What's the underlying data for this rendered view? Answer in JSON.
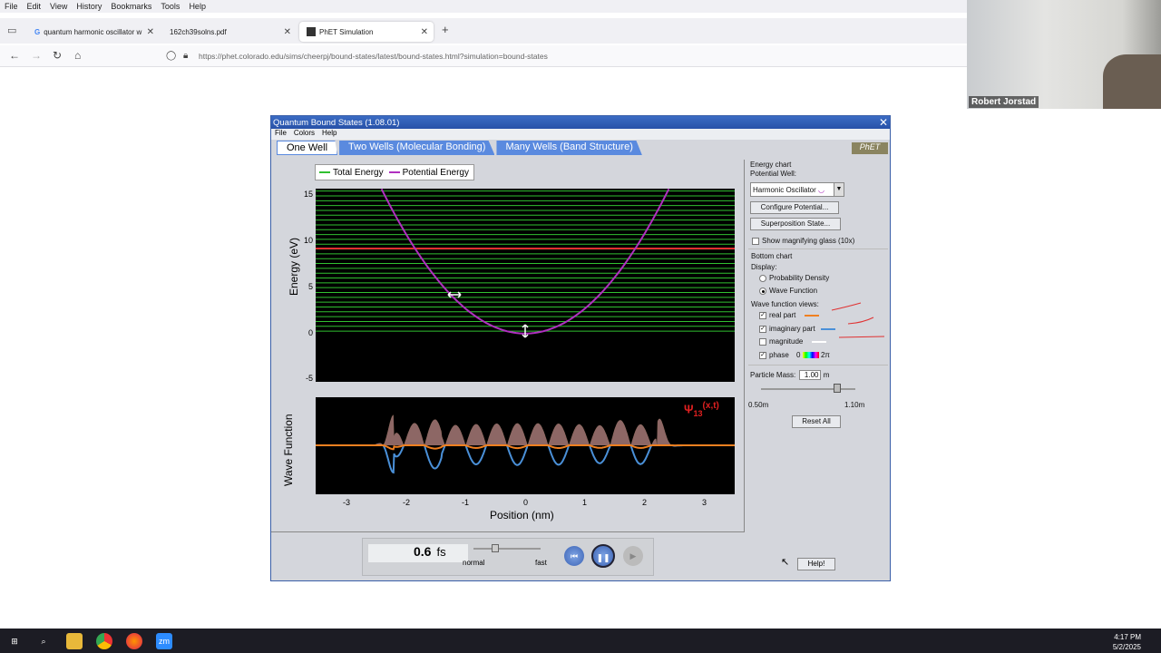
{
  "browser": {
    "menu": [
      "File",
      "Edit",
      "View",
      "History",
      "Bookmarks",
      "Tools",
      "Help"
    ],
    "tabs": [
      {
        "label": "quantum harmonic oscillator w"
      },
      {
        "label": "162ch39solns.pdf"
      },
      {
        "label": "PhET Simulation"
      }
    ],
    "url": "https://phet.colorado.edu/sims/cheerpj/bound-states/latest/bound-states.html?simulation=bound-states"
  },
  "zoom": {
    "participant_name": "Robert Jorstad"
  },
  "sim": {
    "title": "Quantum Bound States (1.08.01)",
    "menu": [
      "File",
      "Colors",
      "Help"
    ],
    "tabs": [
      "One Well",
      "Two Wells (Molecular Bonding)",
      "Many Wells (Band Structure)"
    ],
    "logo": "PhET",
    "legend": {
      "total": "Total Energy",
      "potential": "Potential Energy"
    },
    "energy_chart": {
      "ylabel": "Energy (eV)",
      "yticks": [
        "15",
        "10",
        "5",
        "0",
        "-5"
      ]
    },
    "wave_chart": {
      "ylabel": "Wave Function",
      "psi": "Ψ",
      "psi_sub": "13",
      "psi_args": "(x,t)"
    },
    "xticks": [
      "-3",
      "-2",
      "-1",
      "0",
      "1",
      "2",
      "3"
    ],
    "xlabel": "Position (nm)",
    "panel": {
      "energy_chart_title": "Energy chart",
      "potential_well_label": "Potential Well:",
      "potential_value": "Harmonic Oscillator",
      "configure_button": "Configure Potential...",
      "superposition_button": "Superposition State...",
      "magnify_label": "Show magnifying glass (10x)",
      "bottom_chart_title": "Bottom chart",
      "display_label": "Display:",
      "prob_density": "Probability Density",
      "wave_function": "Wave Function",
      "views_label": "Wave function views:",
      "real_part": "real part",
      "imaginary_part": "imaginary part",
      "magnitude": "magnitude",
      "phase": "phase",
      "phase_zero": "0",
      "phase_2pi": "2π",
      "mass_label": "Particle Mass:",
      "mass_value": "1.00",
      "mass_unit": "m",
      "mass_min": "0.50m",
      "mass_max": "1.10m",
      "reset_button": "Reset All"
    },
    "clock": {
      "time": "0.6",
      "unit": "fs",
      "normal": "normal",
      "fast": "fast"
    },
    "help_button": "Help!"
  },
  "taskbar": {
    "time": "4:17 PM",
    "date": "5/2/2025"
  },
  "colors": {
    "title": "#2851a8",
    "tab": "#5a8adf",
    "green": "#30c030",
    "purple": "#b030c0",
    "red": "#e02020"
  }
}
